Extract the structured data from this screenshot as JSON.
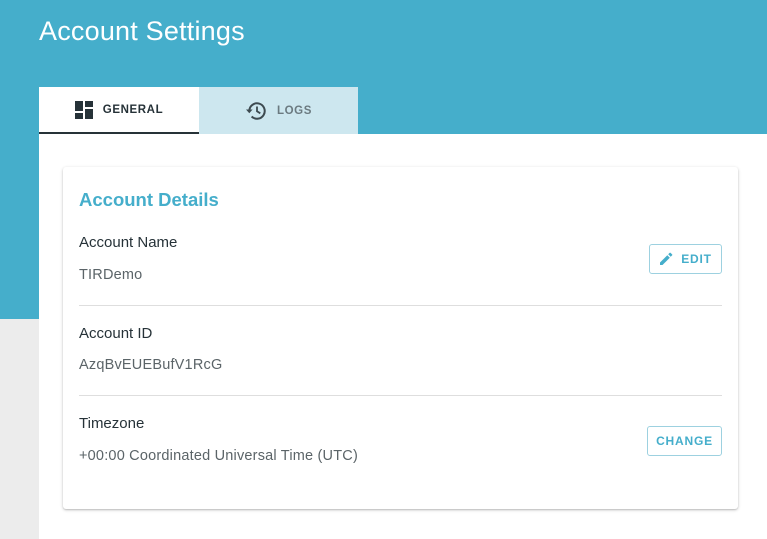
{
  "header": {
    "title": "Account Settings",
    "background_color": "#45aecb"
  },
  "tabs": [
    {
      "label": "GENERAL",
      "icon": "dashboard-icon",
      "active": true
    },
    {
      "label": "LOGS",
      "icon": "history-icon",
      "active": false
    }
  ],
  "account_details": {
    "title": "Account Details",
    "account_name": {
      "label": "Account Name",
      "value": "TIRDemo",
      "action_label": "EDIT",
      "action_icon": "pencil-icon"
    },
    "account_id": {
      "label": "Account ID",
      "value": "AzqBvEUEBufV1RcG"
    },
    "timezone": {
      "label": "Timezone",
      "value": "+00:00 Coordinated Universal Time (UTC)",
      "action_label": "CHANGE"
    }
  },
  "colors": {
    "accent": "#45aecb",
    "text_dark": "#263238",
    "text_muted": "#5b6468",
    "inactive_tab": "#cde7ef"
  }
}
